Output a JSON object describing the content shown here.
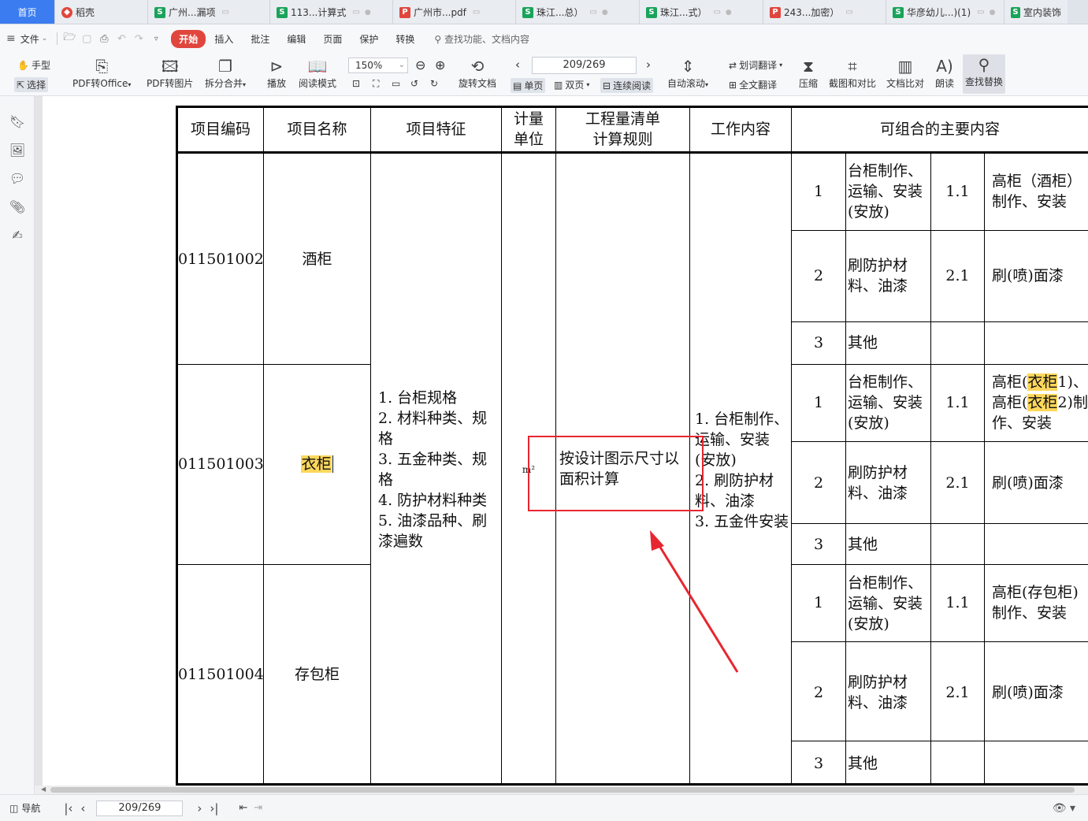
{
  "tabs": [
    {
      "label": "首页",
      "type": "home"
    },
    {
      "label": "稻壳",
      "type": "daoke"
    },
    {
      "label": "广州...漏项",
      "type": "s"
    },
    {
      "label": "113...计算式",
      "type": "s"
    },
    {
      "label": "广州市...pdf",
      "type": "p"
    },
    {
      "label": "珠江...总）",
      "type": "s"
    },
    {
      "label": "珠江...式）",
      "type": "s"
    },
    {
      "label": "243...加密）",
      "type": "p"
    },
    {
      "label": "华彦幼儿...)(1)",
      "type": "s"
    },
    {
      "label": "室内装饰",
      "type": "s"
    }
  ],
  "menu": {
    "file": "文件",
    "items": [
      "开始",
      "插入",
      "批注",
      "编辑",
      "页面",
      "保护",
      "转换"
    ],
    "active": "开始",
    "search_placeholder": "查找功能、文档内容"
  },
  "toolbar": {
    "hand": "手型",
    "select": "选择",
    "pdf_to_office": "PDF转Office",
    "pdf_to_image": "PDF转图片",
    "split_merge": "拆分合并",
    "play": "播放",
    "read_mode": "阅读模式",
    "zoom": "150%",
    "page_value": "209/269",
    "rotate": "旋转文档",
    "single_page": "单页",
    "double_page": "双页",
    "continuous": "连续阅读",
    "auto_scroll": "自动滚动",
    "word_translate": "划词翻译",
    "full_translate": "全文翻译",
    "compress": "压缩",
    "screenshot_compare": "截图和对比",
    "doc_compare": "文档比对",
    "read_aloud": "朗读",
    "find_replace": "查找替换"
  },
  "table": {
    "headers": {
      "code": "项目编码",
      "name": "项目名称",
      "feature": "项目特征",
      "unit_l1": "计量",
      "unit_l2": "单位",
      "rule_l1": "工程量清单",
      "rule_l2": "计算规则",
      "work": "工作内容",
      "main": "可组合的主要内容"
    },
    "items": [
      {
        "code": "011501002",
        "name": "酒柜"
      },
      {
        "code": "011501003",
        "name": "衣柜"
      },
      {
        "code": "011501004",
        "name": "存包柜"
      }
    ],
    "feature_lines": [
      "1. 台柜规格",
      "2. 材料种类、规",
      "格",
      "3. 五金种类、规",
      "格",
      "4. 防护材料种类",
      "5. 油漆品种、刷",
      "漆遍数"
    ],
    "unit": "m²",
    "rule_lines": [
      "按设计图示尺寸以",
      "面积计算"
    ],
    "work_lines": [
      "1. 台柜制作、",
      "运输、安装",
      "(安放)",
      "2. 刷防护材",
      "料、油漆",
      "3. 五金件安装"
    ],
    "sub": {
      "n1": "1",
      "n2": "2",
      "n3": "3",
      "c1": [
        "台柜制作、",
        "运输、安装",
        "(安放)"
      ],
      "c2": [
        "刷防护材",
        "料、油漆"
      ],
      "c3": "其他",
      "code11": "1.1",
      "code21": "2.1",
      "paint": "刷(喷)面漆",
      "g1_main": [
        "高柜（酒柜）",
        "制作、安装"
      ],
      "g2_main_a": "高柜(",
      "g2_main_hl": "衣柜",
      "g2_main_a_end": "1)、",
      "g2_main_b_end": "2)制",
      "g2_main_c": "作、安装",
      "g3_main": [
        "高柜(存包柜)",
        "制作、安装"
      ]
    }
  },
  "status": {
    "nav": "导航",
    "page_value": "209/269"
  }
}
